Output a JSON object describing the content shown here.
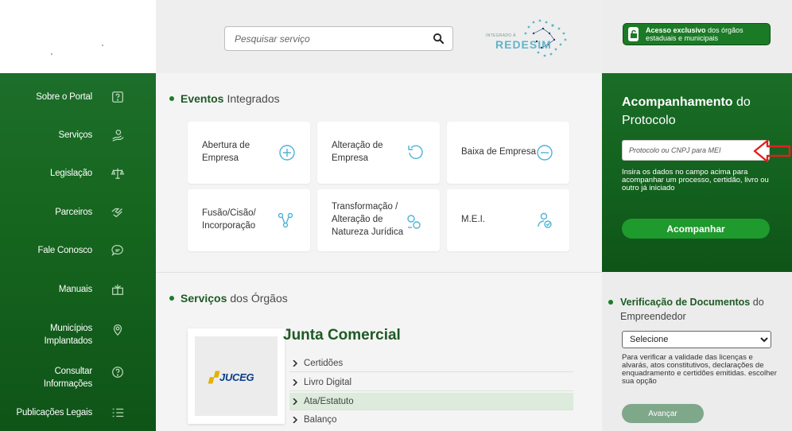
{
  "search": {
    "placeholder": "Pesquisar serviço"
  },
  "redesim": {
    "small": "INTEGRADO À",
    "text": "REDESIM"
  },
  "exclusive": {
    "strong": "Acesso exclusivo",
    "rest": " dos órgãos estaduais e municipais"
  },
  "sidebar": {
    "items": [
      {
        "label": "Sobre o Portal",
        "icon": "help-square-icon"
      },
      {
        "label": "Serviços",
        "icon": "user-hand-icon"
      },
      {
        "label": "Legislação",
        "icon": "scales-icon"
      },
      {
        "label": "Parceiros",
        "icon": "handshake-icon"
      },
      {
        "label": "Fale Conosco",
        "icon": "chat-icon"
      },
      {
        "label": "Manuais",
        "icon": "book-icon"
      },
      {
        "label": "Municípios Implantados",
        "icon": "map-pin-icon"
      },
      {
        "label": "Consultar Informações",
        "icon": "question-circle-icon"
      },
      {
        "label": "Publicações Legais",
        "icon": "list-icon"
      }
    ]
  },
  "eventos": {
    "title_strong": "Eventos",
    "title_rest": "Integrados",
    "cards": [
      {
        "label": "Abertura de Empresa",
        "icon": "plus-circle-icon"
      },
      {
        "label": "Alteração de Empresa",
        "icon": "refresh-icon"
      },
      {
        "label": "Baixa de Empresa",
        "icon": "minus-circle-icon"
      },
      {
        "label": "Fusão/Cisão/ Incorporação",
        "icon": "network-icon"
      },
      {
        "label": "Transformação / Alteração de Natureza Jurídica",
        "icon": "transform-icon"
      },
      {
        "label": "M.E.I.",
        "icon": "user-check-icon"
      }
    ]
  },
  "servicos": {
    "title_strong": "Serviços",
    "title_rest": "dos Órgãos",
    "org_title": "Junta Comercial",
    "logo_text": "JUCEG",
    "links": [
      "Certidões",
      "Livro Digital",
      "Ata/Estatuto",
      "Balanço"
    ]
  },
  "protocolo": {
    "title_strong": "Acompanhamento",
    "title_rest": " do Protocolo",
    "placeholder": "Protocolo ou CNPJ para MEI",
    "help": "Insira os dados no campo acima para acompanhar um processo, certidão, livro ou outro já iniciado",
    "button": "Acompanhar"
  },
  "verificacao": {
    "title_strong": "Verificação de Documentos",
    "title_rest": " do Empreendedor",
    "selected": "Selecione",
    "help": "Para verificar a validade das licenças e alvarás, atos constitutivos, declarações de enquadramento e certidões emitidas. escolher sua opção",
    "button": "Avançar"
  },
  "colors": {
    "brand_green": "#1a6d27",
    "accent_blue": "#4fb3d6",
    "alert_red": "#e02020"
  }
}
